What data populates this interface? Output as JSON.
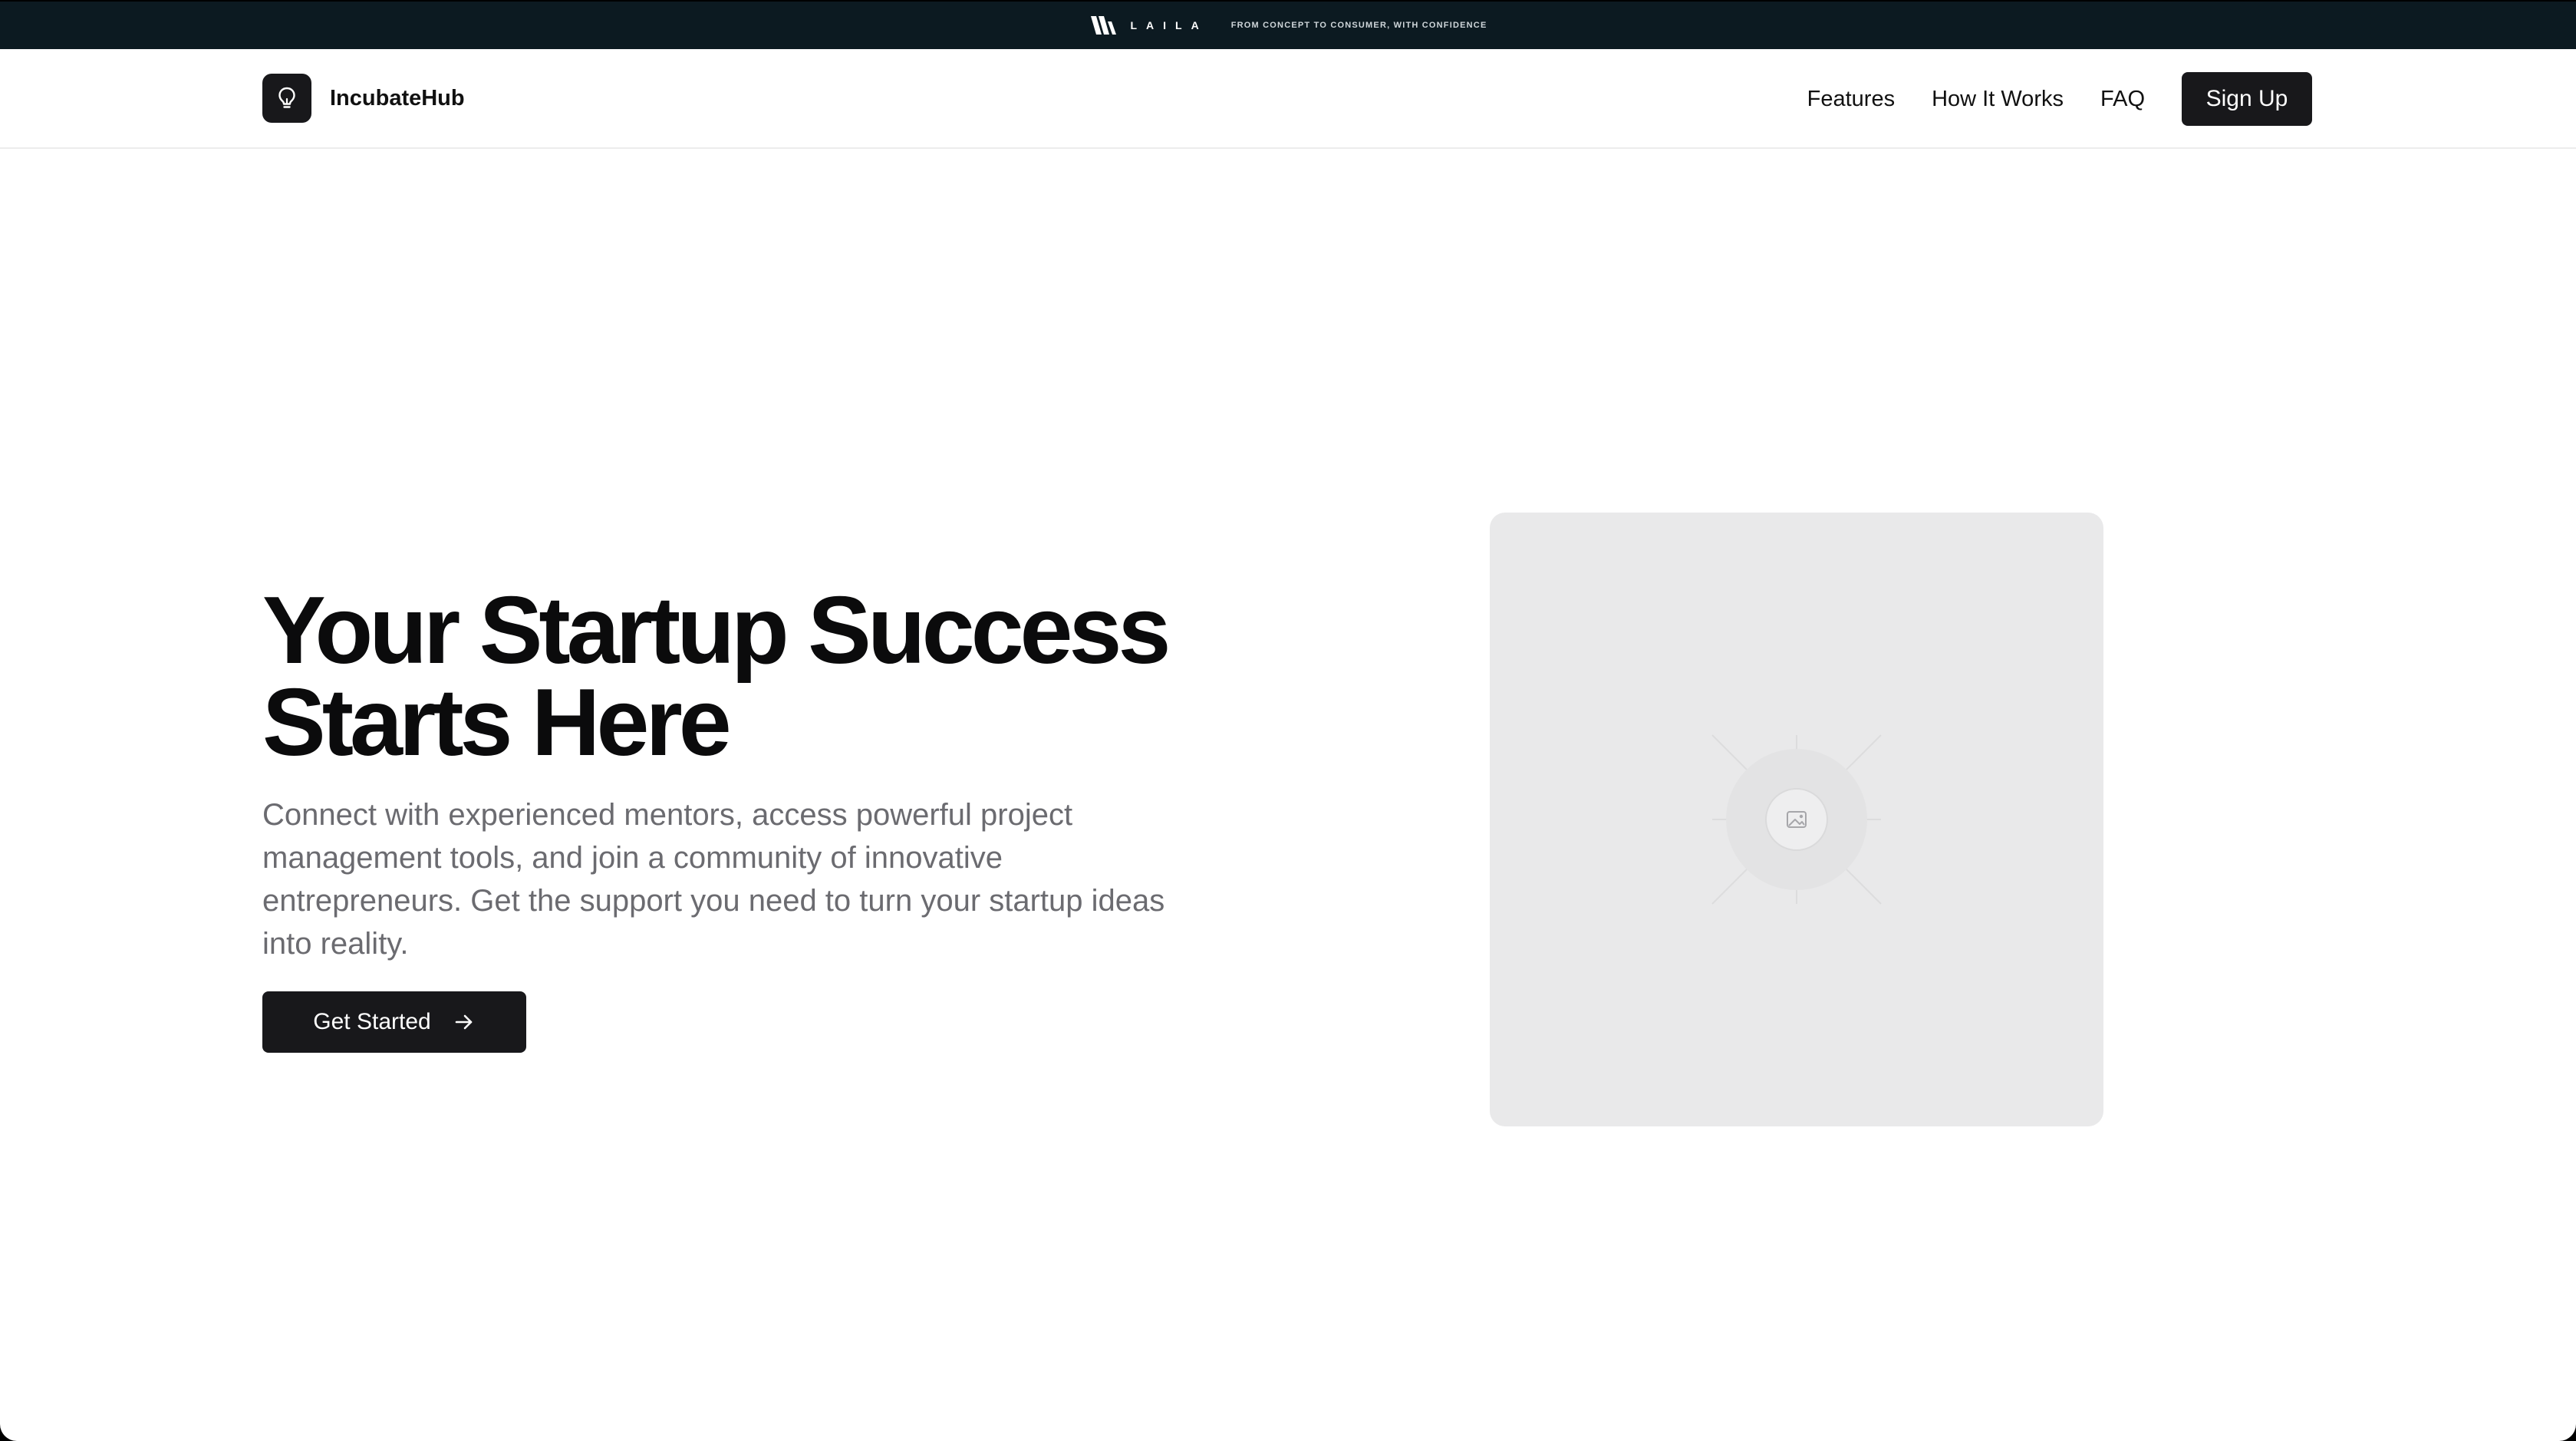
{
  "banner": {
    "wordmark": "LAILA",
    "tagline": "FROM CONCEPT TO CONSUMER, WITH CONFIDENCE",
    "logo_icon": "laila-logo-icon"
  },
  "nav": {
    "brand_name": "IncubateHub",
    "brand_icon": "lightbulb-icon",
    "links": [
      {
        "label": "Features"
      },
      {
        "label": "How It Works"
      },
      {
        "label": "FAQ"
      }
    ],
    "signup_label": "Sign Up"
  },
  "hero": {
    "title_line1": "Your Startup Success",
    "title_line2": "Starts Here",
    "subtitle": "Connect with experienced mentors, access powerful project management tools, and join a community of innovative entrepreneurs. Get the support you need to turn your startup ideas into reality.",
    "cta_label": "Get Started",
    "cta_icon": "arrow-right-icon"
  },
  "media": {
    "placeholder_icon": "image-placeholder-icon"
  },
  "colors": {
    "banner_bg": "#0c1a21",
    "primary_button": "#18181b",
    "title_text": "#0b0b0c",
    "subtitle_text": "#6b6b70",
    "placeholder_bg": "#e9e9ea"
  }
}
